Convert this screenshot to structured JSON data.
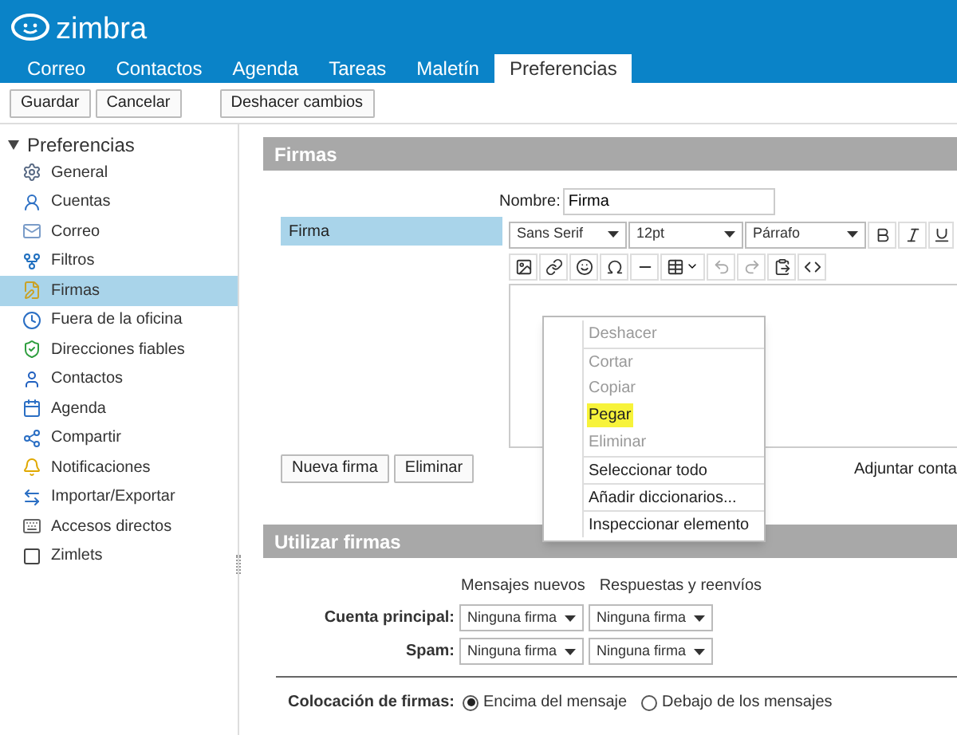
{
  "app": {
    "name": "zimbra"
  },
  "tabs": [
    {
      "label": "Correo",
      "selected": false
    },
    {
      "label": "Contactos",
      "selected": false
    },
    {
      "label": "Agenda",
      "selected": false
    },
    {
      "label": "Tareas",
      "selected": false
    },
    {
      "label": "Maletín",
      "selected": false
    },
    {
      "label": "Preferencias",
      "selected": true
    }
  ],
  "toolbar": {
    "left": [
      "Guardar",
      "Cancelar"
    ],
    "right": [
      "Deshacer cambios"
    ]
  },
  "sidebar": {
    "title": "Preferencias",
    "expanded": true,
    "items": [
      {
        "label": "General",
        "selected": false
      },
      {
        "label": "Cuentas",
        "selected": false
      },
      {
        "label": "Correo",
        "selected": false
      },
      {
        "label": "Filtros",
        "selected": false
      },
      {
        "label": "Firmas",
        "selected": true
      },
      {
        "label": "Fuera de la oficina",
        "selected": false
      },
      {
        "label": "Direcciones fiables",
        "selected": false
      },
      {
        "label": "Contactos",
        "selected": false
      },
      {
        "label": "Agenda",
        "selected": false
      },
      {
        "label": "Compartir",
        "selected": false
      },
      {
        "label": "Notificaciones",
        "selected": false
      },
      {
        "label": "Importar/Exportar",
        "selected": false
      },
      {
        "label": "Accesos directos",
        "selected": false
      },
      {
        "label": "Zimlets",
        "selected": false
      }
    ]
  },
  "signatures": {
    "title": "Firmas",
    "list": [
      {
        "label": "Firma",
        "selected": true
      }
    ],
    "name_label": "Nombre:",
    "name_value": "Firma",
    "font": "Sans Serif",
    "size": "12pt",
    "format": "Párrafo",
    "buttons": [
      "Nueva firma",
      "Eliminar"
    ],
    "attach_label": "Adjuntar conta"
  },
  "context_menu": [
    {
      "label": "Deshacer",
      "disabled": true,
      "selected": false
    },
    {
      "label": "Cortar",
      "disabled": true,
      "selected": false
    },
    {
      "label": "Copiar",
      "disabled": true,
      "selected": false
    },
    {
      "label": "Pegar",
      "disabled": false,
      "selected": true
    },
    {
      "label": "Eliminar",
      "disabled": true,
      "selected": false
    },
    {
      "label": "Seleccionar todo",
      "disabled": false,
      "selected": false
    },
    {
      "label": "Añadir diccionarios...",
      "disabled": false,
      "selected": false
    },
    {
      "label": "Inspeccionar elemento",
      "disabled": false,
      "selected": false
    }
  ],
  "use_signatures": {
    "title": "Utilizar firmas",
    "columns": [
      "Mensajes nuevos",
      "Respuestas y reenvíos"
    ],
    "rows": [
      {
        "label": "Cuenta principal:",
        "values": [
          "Ninguna firma",
          "Ninguna firma"
        ]
      },
      {
        "label": "Spam:",
        "values": [
          "Ninguna firma",
          "Ninguna firma"
        ]
      }
    ],
    "placement_label": "Colocación de firmas:",
    "placement_options": [
      {
        "label": "Encima del mensaje",
        "selected": true
      },
      {
        "label": "Debajo de los mensajes",
        "selected": false
      }
    ]
  }
}
